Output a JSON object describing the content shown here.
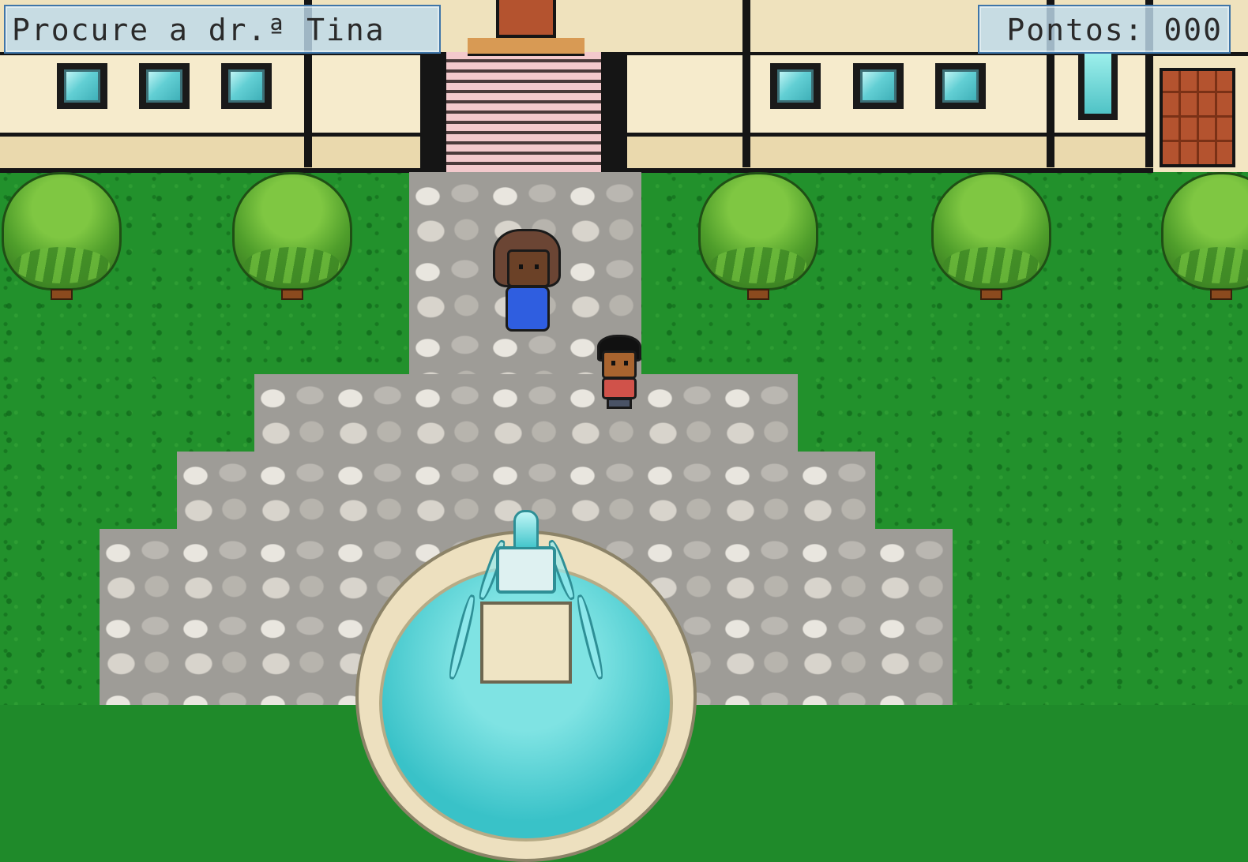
{
  "hud": {
    "objective_text": "Procure a dr.ª Tina",
    "score_label": "Pontos:",
    "score_value": "000"
  },
  "scene": {
    "location": "courtyard",
    "grass_color": "#22912c",
    "path_color": "#9e9c97",
    "water_color": "#39c2c8",
    "hud_bg_color": "#bedaec",
    "hud_border_color": "#3f75a8"
  },
  "characters": [
    {
      "role": "woman-npc",
      "shirt_color": "#2f5ee0",
      "hair_color": "#6b4534"
    },
    {
      "role": "player-boy",
      "shirt_color": "#d0524a",
      "hair_color": "#111111"
    }
  ]
}
